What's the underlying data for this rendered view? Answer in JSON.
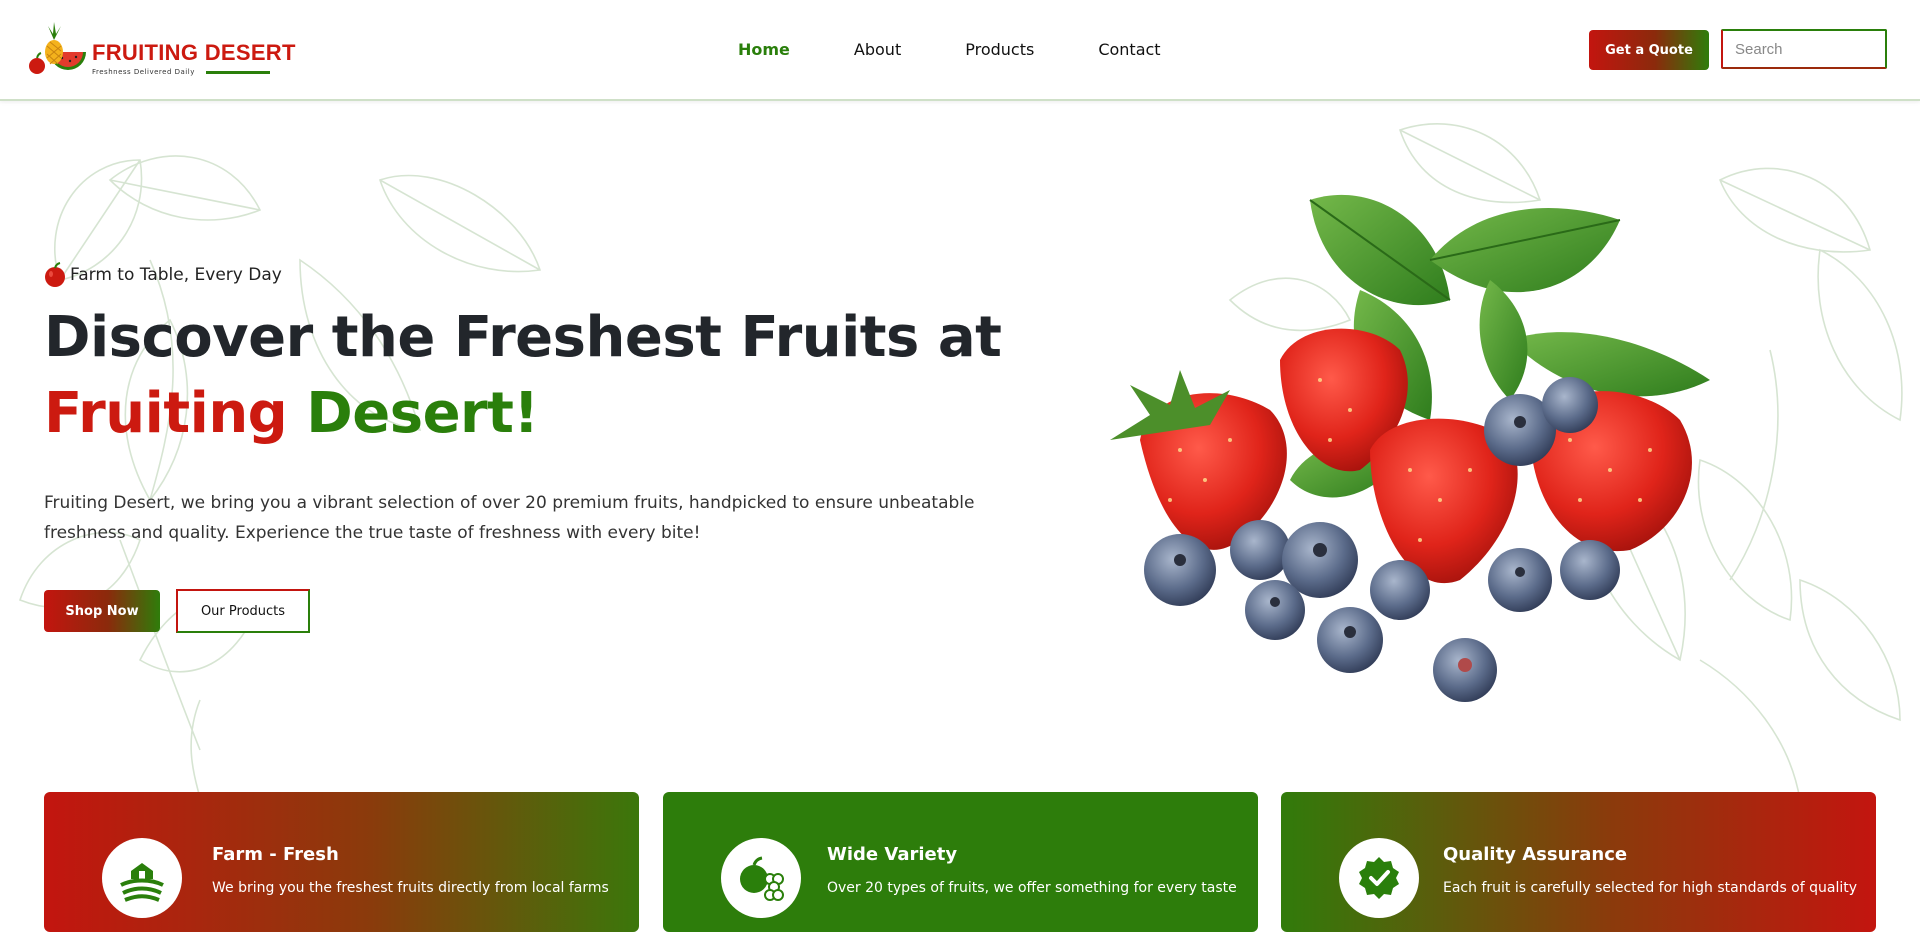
{
  "brand": {
    "name": "FRUITING DESERT",
    "tagline": "Freshness Delivered Daily"
  },
  "nav": {
    "items": [
      {
        "label": "Home",
        "active": true
      },
      {
        "label": "About",
        "active": false
      },
      {
        "label": "Products",
        "active": false
      },
      {
        "label": "Contact",
        "active": false
      }
    ]
  },
  "header": {
    "quote_label": "Get a Quote",
    "search_placeholder": "Search"
  },
  "hero": {
    "kicker": "Farm to Table, Every Day",
    "title_line1": "Discover the Freshest Fruits at",
    "title_red": "Fruiting",
    "title_green": "Desert!",
    "description": "Fruiting Desert, we bring you a vibrant selection of over 20 premium fruits, handpicked to ensure unbeatable freshness and quality. Experience the true taste of freshness with every bite!",
    "shop_label": "Shop Now",
    "products_label": "Our Products"
  },
  "features": [
    {
      "title": "Farm - Fresh",
      "text": "We bring you the freshest fruits directly from local farms",
      "icon": "farm-icon"
    },
    {
      "title": "Wide Variety",
      "text": "Over 20 types of fruits, we offer something for every taste",
      "icon": "fruits-icon"
    },
    {
      "title": "Quality Assurance",
      "text": "Each fruit is carefully selected for high standards of quality",
      "icon": "quality-badge-icon"
    }
  ],
  "colors": {
    "brand_red": "#cc1a10",
    "brand_green": "#2a7f0b",
    "heading_dark": "#22262b"
  }
}
